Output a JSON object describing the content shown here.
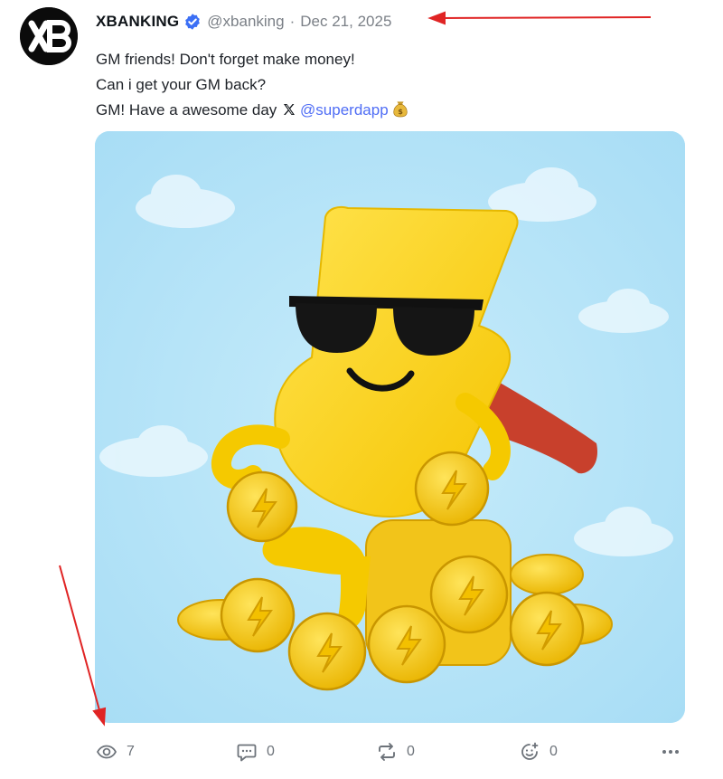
{
  "post": {
    "author_name": "XBANKING",
    "handle": "@xbanking",
    "separator": "·",
    "date": "Dec 21, 2025",
    "avatar_text": "XB",
    "lines": [
      "GM friends! Don't forget make money!",
      "Can i get your GM back?",
      "GM! Have a awesome day"
    ],
    "mention": "@superdapp",
    "icons": {
      "verified": "verified-badge-icon",
      "x_logo": "x-logo-icon",
      "emoji": "money-bag-icon"
    },
    "colors": {
      "verified": "#3b6ff5",
      "mention": "#4f6df5",
      "image_bg": "#aee0f7",
      "arrow": "#e02424"
    }
  },
  "actions": {
    "views": {
      "icon": "eye-icon",
      "count": "7"
    },
    "replies": {
      "icon": "comment-icon",
      "count": "0"
    },
    "reposts": {
      "icon": "repost-icon",
      "count": "0"
    },
    "reactions": {
      "icon": "add-reaction-icon",
      "count": "0"
    },
    "more": {
      "icon": "more-dots-icon"
    }
  }
}
